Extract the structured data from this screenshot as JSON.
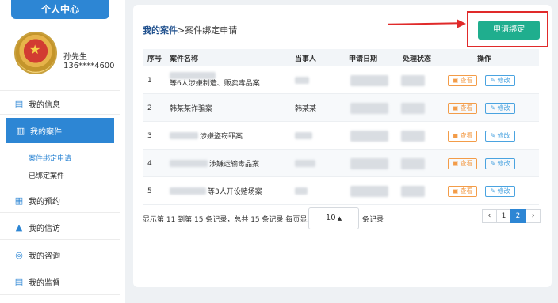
{
  "sidebar": {
    "title": "个人中心",
    "user": {
      "name": "孙先生",
      "phone": "136****4600"
    },
    "items": [
      {
        "label": "我的信息",
        "icon": "id-card-icon"
      },
      {
        "label": "我的案件",
        "icon": "book-icon"
      },
      {
        "label": "我的预约",
        "icon": "calendar-icon"
      },
      {
        "label": "我的信访",
        "icon": "alarm-light-icon"
      },
      {
        "label": "我的咨询",
        "icon": "chat-icon"
      },
      {
        "label": "我的监督",
        "icon": "id-card-icon"
      }
    ],
    "sub_items": [
      {
        "label": "案件绑定申请"
      },
      {
        "label": "已绑定案件"
      }
    ]
  },
  "main": {
    "breadcrumb": {
      "root": "我的案件",
      "separator": ">",
      "current": "案件绑定申请"
    },
    "apply_button": "申请绑定",
    "table": {
      "headers": [
        "序号",
        "案件名称",
        "当事人",
        "申请日期",
        "处理状态",
        "操作"
      ],
      "rows": [
        {
          "no": "1",
          "case_name": "等6人涉嫌制造、贩卖毒品案",
          "party": ""
        },
        {
          "no": "2",
          "case_name": "韩某某诈骗案",
          "party": "韩某某"
        },
        {
          "no": "3",
          "case_name": "涉嫌盗窃罪案",
          "party": ""
        },
        {
          "no": "4",
          "case_name": "涉嫌运输毒品案",
          "party": ""
        },
        {
          "no": "5",
          "case_name": "等3人开设赌场案",
          "party": ""
        }
      ],
      "view_label": "查看",
      "edit_label": "修改"
    },
    "pagination": {
      "summary": "显示第 11 到第 15 条记录，总共 15 条记录 每页显示",
      "page_size": "10",
      "suffix": "条记录",
      "pages": [
        "‹",
        "1",
        "2",
        "›"
      ],
      "current_page": "2"
    }
  },
  "colors": {
    "primary": "#2d86d4",
    "apply": "#1fae8e",
    "highlight": "#e02a2a",
    "view": "#f39c48",
    "edit": "#4aa3e0"
  }
}
